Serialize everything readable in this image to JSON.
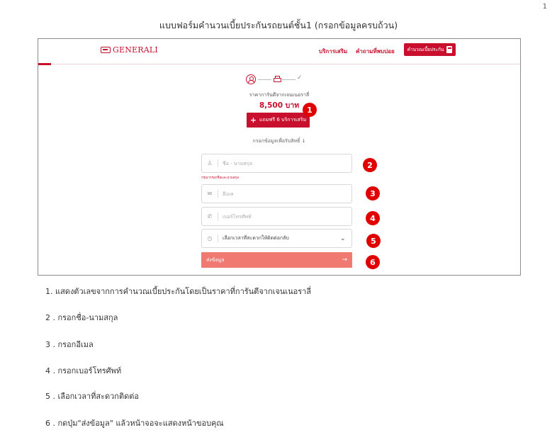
{
  "page_number": "1",
  "document_title": "แบบฟอร์มคำนวนเบี้ยประกันรถยนต์ชั้น1 (กรอกข้อมูลครบถ้วน)",
  "screenshot": {
    "brand": "GENERALI",
    "nav": {
      "services_label": "บริการเสริม",
      "faq_label": "คำถามที่พบบ่อย",
      "cta_label": "คำนวณเบี้ยประกัน"
    },
    "stepper": {
      "done_mark": "✓"
    },
    "price": {
      "label": "ราคาการันตีจากเจนเนอราลี่",
      "value": "8,500 บาท"
    },
    "addon_button": {
      "icon": "+",
      "label": "แถมฟรี 6 บริการเสริม"
    },
    "form_caption": "กรอกข้อมูลเพื่อรับสิทธิ์ ↓",
    "fields": {
      "name_placeholder": "ชื่อ - นามสกุล",
      "name_hint": "กรุณากรอกชื่อและนามสกุล",
      "email_placeholder": "อีเมล",
      "phone_placeholder": "เบอร์โทรศัพท์",
      "time_value": "เลือกเวลาที่สะดวกให้ติดต่อกลับ"
    },
    "submit": {
      "label": "ส่งข้อมูล",
      "arrow": "→"
    },
    "markers": [
      "1",
      "2",
      "3",
      "4",
      "5",
      "6"
    ]
  },
  "step_notes": [
    "1. แสดงตัวเลขจากการคำนวณเบี้ยประกันโดยเป็นราคาที่การันตีจากเจนเนอราลี่",
    "2 . กรอกชื่อ-นามสกุล",
    "3 . กรอกอีเมล",
    "4 . กรอกเบอร์โทรศัพท์",
    "5 . เลือกเวลาที่สะดวกติดต่อ",
    "6 . กดปุ่ม\"ส่งข้อมูล\" แล้วหน้าจอจะแสดงหน้าขอบคุณ"
  ]
}
